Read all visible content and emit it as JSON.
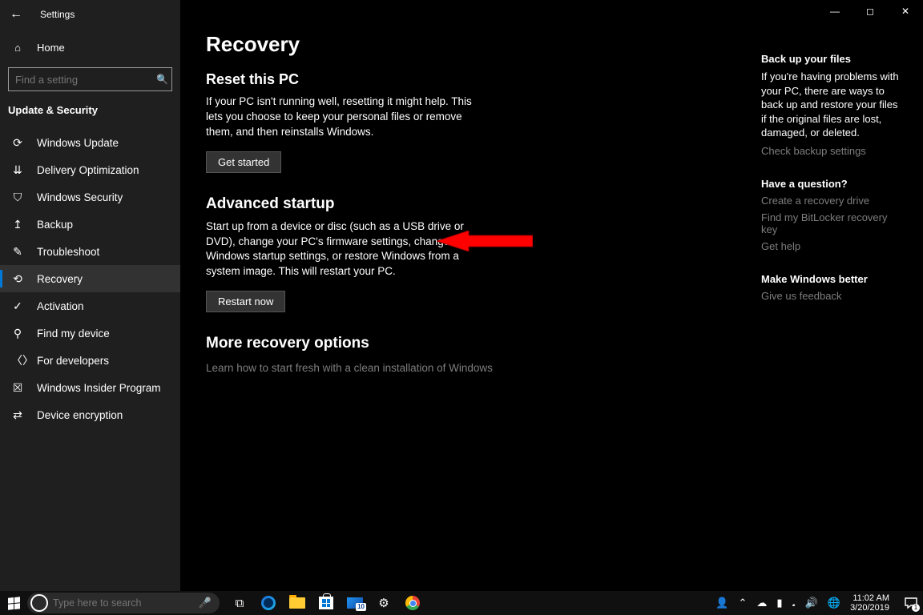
{
  "header": {
    "app_title": "Settings"
  },
  "sidebar": {
    "home_label": "Home",
    "search_placeholder": "Find a setting",
    "group_title": "Update & Security",
    "items": [
      {
        "icon": "sync",
        "label": "Windows Update"
      },
      {
        "icon": "delivery",
        "label": "Delivery Optimization"
      },
      {
        "icon": "shield",
        "label": "Windows Security"
      },
      {
        "icon": "backup",
        "label": "Backup"
      },
      {
        "icon": "troubleshoot",
        "label": "Troubleshoot"
      },
      {
        "icon": "recovery",
        "label": "Recovery"
      },
      {
        "icon": "activation",
        "label": "Activation"
      },
      {
        "icon": "find",
        "label": "Find my device"
      },
      {
        "icon": "developer",
        "label": "For developers"
      },
      {
        "icon": "insider",
        "label": "Windows Insider Program"
      },
      {
        "icon": "encryption",
        "label": "Device encryption"
      }
    ],
    "selected_index": 5
  },
  "page": {
    "title": "Recovery",
    "reset": {
      "heading": "Reset this PC",
      "blurb": "If your PC isn't running well, resetting it might help. This lets you choose to keep your personal files or remove them, and then reinstalls Windows.",
      "button": "Get started"
    },
    "advanced": {
      "heading": "Advanced startup",
      "blurb": "Start up from a device or disc (such as a USB drive or DVD), change your PC's firmware settings, change Windows startup settings, or restore Windows from a system image. This will restart your PC.",
      "button": "Restart now"
    },
    "more": {
      "heading": "More recovery options",
      "link": "Learn how to start fresh with a clean installation of Windows"
    }
  },
  "right": {
    "backup": {
      "heading": "Back up your files",
      "body": "If you're having problems with your PC, there are ways to back up and restore your files if the original files are lost, damaged, or deleted.",
      "link": "Check backup settings"
    },
    "question": {
      "heading": "Have a question?",
      "links": [
        "Create a recovery drive",
        "Find my BitLocker recovery key",
        "Get help"
      ]
    },
    "better": {
      "heading": "Make Windows better",
      "link": "Give us feedback"
    }
  },
  "taskbar": {
    "search_placeholder": "Type here to search",
    "mail_badge": "10",
    "time": "11:02 AM",
    "date": "3/20/2019",
    "notif_count": "1"
  },
  "icon_glyphs": {
    "sync": "⟳",
    "delivery": "⇊",
    "shield": "⛉",
    "backup": "↥",
    "troubleshoot": "✎",
    "recovery": "⟲",
    "activation": "✓",
    "find": "⚲",
    "developer": "〈〉",
    "insider": "☒",
    "encryption": "⇄",
    "home": "⌂"
  }
}
